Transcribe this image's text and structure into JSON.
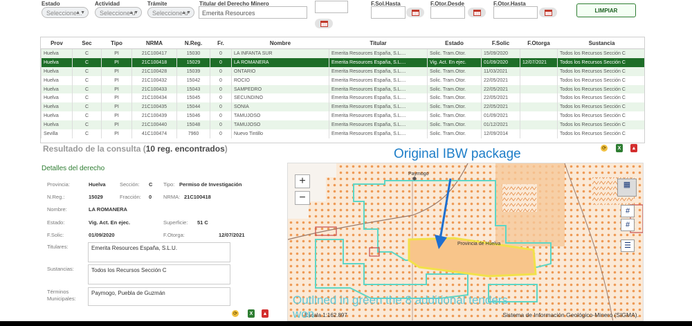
{
  "filters": {
    "estado_label": "Estado",
    "estado_value": "Seleccione...",
    "actividad_label": "Actividad",
    "actividad_value": "Seleccione u",
    "tramite_label": "Trámite",
    "tramite_value": "Seleccione u",
    "titular_label": "Titular del Derecho Minero",
    "titular_value": "Emerita Resources",
    "fsol_label": "F.Sol.Hasta",
    "fotor_desde_label": "F.Otor.Desde",
    "fotor_hasta_label": "F.Otor.Hasta",
    "limpiar_label": "LIMPIAR"
  },
  "table": {
    "headers": [
      "Prov",
      "Sec",
      "Tipo",
      "NRMA",
      "N.Reg.",
      "Fr.",
      "Nombre",
      "Titular",
      "Estado",
      "F.Solic",
      "F.Otorga",
      "Sustancia"
    ],
    "rows": [
      [
        "Huelva",
        "C",
        "PI",
        "21C100417",
        "15030",
        "0",
        "LA INFANTA SUR",
        "Emerita Resources España, S.L....",
        "Solic. Tram.Otor.",
        "15/09/2020",
        "",
        "Todos los Recursos Sección C"
      ],
      [
        "Huelva",
        "C",
        "PI",
        "21C100418",
        "15029",
        "0",
        "LA ROMANERA",
        "Emerita Resources España, S.L....",
        "Vig. Act. En ejec.",
        "01/09/2020",
        "12/07/2021",
        "Todos los Recursos Sección C"
      ],
      [
        "Huelva",
        "C",
        "PI",
        "21C100428",
        "15039",
        "0",
        "ONTARIO",
        "Emerita Resources España, S.L....",
        "Solic. Tram.Otor.",
        "11/03/2021",
        "",
        "Todos los Recursos Sección C"
      ],
      [
        "Huelva",
        "C",
        "PI",
        "21C100432",
        "15042",
        "0",
        "ROCIO",
        "Emerita Resources España, S.L....",
        "Solic. Tram.Otor.",
        "22/05/2021",
        "",
        "Todos los Recursos Sección C"
      ],
      [
        "Huelva",
        "C",
        "PI",
        "21C100433",
        "15043",
        "0",
        "SAMPEDRO",
        "Emerita Resources España, S.L....",
        "Solic. Tram.Otor.",
        "22/05/2021",
        "",
        "Todos los Recursos Sección C"
      ],
      [
        "Huelva",
        "C",
        "PI",
        "21C100434",
        "15045",
        "0",
        "SECUNDINO",
        "Emerita Resources España, S.L....",
        "Solic. Tram.Otor.",
        "22/05/2021",
        "",
        "Todos los Recursos Sección C"
      ],
      [
        "Huelva",
        "C",
        "PI",
        "21C100435",
        "15044",
        "0",
        "SONIA",
        "Emerita Resources España, S.L....",
        "Solic. Tram.Otor.",
        "22/05/2021",
        "",
        "Todos los Recursos Sección C"
      ],
      [
        "Huelva",
        "C",
        "PI",
        "21C100439",
        "15046",
        "0",
        "TAMUJOSO",
        "Emerita Resources España, S.L....",
        "Solic. Tram.Otor.",
        "01/09/2021",
        "",
        "Todos los Recursos Sección C"
      ],
      [
        "Huelva",
        "C",
        "PI",
        "21C100440",
        "15048",
        "0",
        "TAMUJOSO",
        "Emerita Resources España, S.L....",
        "Solic. Tram.Otor.",
        "01/12/2021",
        "",
        "Todos los Recursos Sección C"
      ],
      [
        "Sevilla",
        "C",
        "PI",
        "41C100474",
        "7960",
        "0",
        "Nuevo Tintillo",
        "Emerita Resources España, S.L....",
        "Solic. Tram.Otor.",
        "12/09/2014",
        "",
        "Todos los Recursos Sección C"
      ]
    ]
  },
  "result": {
    "prefix": "Resultado de la consulta (",
    "count": "10 reg. encontrados",
    "suffix": ")"
  },
  "details": {
    "title": "Detalles del derecho",
    "provincia_label": "Provincia:",
    "provincia_value": "Huelva",
    "seccion_label": "Sección:",
    "seccion_value": "C",
    "tipo_label": "Tipo:",
    "tipo_value": "Permiso de Investigación",
    "nreg_label": "N.Reg.:",
    "nreg_value": "15029",
    "fraccion_label": "Fracción:",
    "fraccion_value": "0",
    "nrma_label": "NRMA:",
    "nrma_value": "21C100418",
    "nombre_label": "Nombre:",
    "nombre_value": "LA ROMANERA",
    "estado_label": "Estado:",
    "estado_value": "Vig. Act. En ejec.",
    "superficie_label": "Superficie:",
    "superficie_value": "51 C",
    "fsolic_label": "F.Solic:",
    "fsolic_value": "01/09/2020",
    "fotorga_label": "F.Otorga:",
    "fotorga_value": "12/07/2021",
    "titulares_label": "Titulares:",
    "titulares_value": "Emerita Resources España, S.L.U.",
    "sustancias_label": "Sustancias:",
    "sustancias_value": "Todos los Recursos Sección C",
    "terminos_label": "Términos Municipales:",
    "terminos_value": "Paymogo, Puebla de Guzmán"
  },
  "map": {
    "town": "Paymogo",
    "province_text": "Provincia de Huelva",
    "zoom_in": "+",
    "zoom_out": "−",
    "scale": "Escala 1:162.897",
    "credit": "Sistema de Información Geológico-Minero (SIGMA).",
    "annotation_top": "Original IBW package",
    "annotation_bottom": "Outlined in green the 8 additional tenders won",
    "colors": {
      "hatch": "#f0a060",
      "outline": "#5dd6c6",
      "highlight": "#f2e14a",
      "arrow": "#1e6fd0"
    }
  },
  "icons": [
    "calendar-icon",
    "refresh-icon",
    "excel-icon",
    "pdf-icon",
    "layers-icon",
    "grid-icon",
    "legend-icon"
  ]
}
